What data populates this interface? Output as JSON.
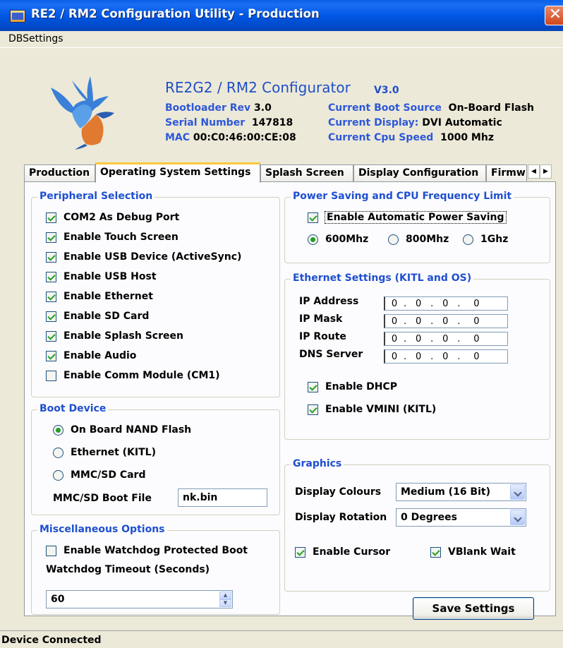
{
  "window": {
    "title": "RE2 / RM2 Configuration Utility - Production",
    "close_glyph": "✕"
  },
  "menu": {
    "items": [
      "DBSettings"
    ]
  },
  "header": {
    "title": "RE2G2 / RM2 Configurator",
    "version": "V3.0",
    "bootloader_label": "Bootloader Rev",
    "bootloader_value": "3.0",
    "serial_label": "Serial Number",
    "serial_value": "147818",
    "mac_label": "MAC",
    "mac_value": "00:C0:46:00:CE:08",
    "boot_source_label": "Current Boot Source",
    "boot_source_value": "On-Board Flash",
    "display_label": "Current Display:",
    "display_value": "DVI Automatic",
    "cpu_label": "Current Cpu Speed",
    "cpu_value": "1000 Mhz",
    "logo_icon": "kingfisher-bird-logo"
  },
  "tabs": [
    "Production",
    "Operating System Settings",
    "Splash Screen",
    "Display Configuration",
    "Firmw"
  ],
  "active_tab": "Operating System Settings",
  "peripheral": {
    "title": "Peripheral Selection",
    "items": [
      {
        "label": "COM2 As Debug Port",
        "checked": true
      },
      {
        "label": "Enable Touch Screen",
        "checked": true
      },
      {
        "label": "Enable USB Device (ActiveSync)",
        "checked": true
      },
      {
        "label": "Enable USB Host",
        "checked": true
      },
      {
        "label": "Enable Ethernet",
        "checked": true
      },
      {
        "label": "Enable SD Card",
        "checked": true
      },
      {
        "label": "Enable Splash Screen",
        "checked": true
      },
      {
        "label": "Enable Audio",
        "checked": true
      },
      {
        "label": "Enable Comm Module (CM1)",
        "checked": false
      }
    ]
  },
  "boot": {
    "title": "Boot Device",
    "options": [
      {
        "label": "On Board NAND Flash",
        "selected": true
      },
      {
        "label": "Ethernet (KITL)",
        "selected": false
      },
      {
        "label": "MMC/SD Card",
        "selected": false
      }
    ],
    "file_label": "MMC/SD Boot File",
    "file_value": "nk.bin"
  },
  "misc": {
    "title": "Miscellaneous Options",
    "watchdog_label": "Enable Watchdog Protected Boot",
    "watchdog_checked": false,
    "timeout_label": "Watchdog Timeout (Seconds)",
    "timeout_value": "60"
  },
  "power": {
    "title": "Power Saving and CPU Frequency Limit",
    "auto_label": "Enable Automatic Power Saving",
    "auto_checked": true,
    "freq_options": [
      {
        "label": "600Mhz",
        "selected": true
      },
      {
        "label": "800Mhz",
        "selected": false
      },
      {
        "label": "1Ghz",
        "selected": false
      }
    ]
  },
  "ethernet": {
    "title": "Ethernet Settings (KITL and OS)",
    "fields": [
      {
        "label": "IP Address",
        "octets": [
          "0",
          "0",
          "0",
          "0"
        ]
      },
      {
        "label": "IP Mask",
        "octets": [
          "0",
          "0",
          "0",
          "0"
        ]
      },
      {
        "label": "IP Route",
        "octets": [
          "0",
          "0",
          "0",
          "0"
        ]
      },
      {
        "label": "DNS Server",
        "octets": [
          "0",
          "0",
          "0",
          "0"
        ]
      }
    ],
    "dhcp_label": "Enable DHCP",
    "dhcp_checked": true,
    "vmini_label": "Enable VMINI (KITL)",
    "vmini_checked": true
  },
  "graphics": {
    "title": "Graphics",
    "colours_label": "Display Colours",
    "colours_value": "Medium (16 Bit)",
    "rotation_label": "Display Rotation",
    "rotation_value": "0 Degrees",
    "cursor_label": "Enable Cursor",
    "cursor_checked": true,
    "vblank_label": "VBlank Wait",
    "vblank_checked": true
  },
  "save_button": "Save Settings",
  "status": "Device Connected",
  "colors": {
    "title_blue": "#0058E6",
    "label_blue": "#1F4FD0",
    "check_green": "#21A121",
    "tab_highlight": "#FFC83C"
  }
}
